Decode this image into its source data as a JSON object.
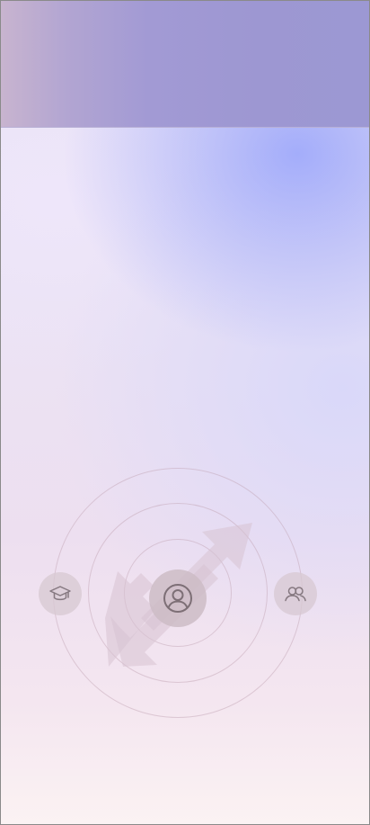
{
  "screen": {
    "background_top_color": "#9d97d2",
    "background_bottom_color": "#fbf2f3",
    "accent_ring_color": "#c8a8b6"
  },
  "wheel": {
    "center_icon": "user-circle-icon",
    "left_icon": "graduation-cap-icon",
    "right_icon": "people-icon",
    "arrow_icon": "diagonal-double-arrow-icon"
  }
}
